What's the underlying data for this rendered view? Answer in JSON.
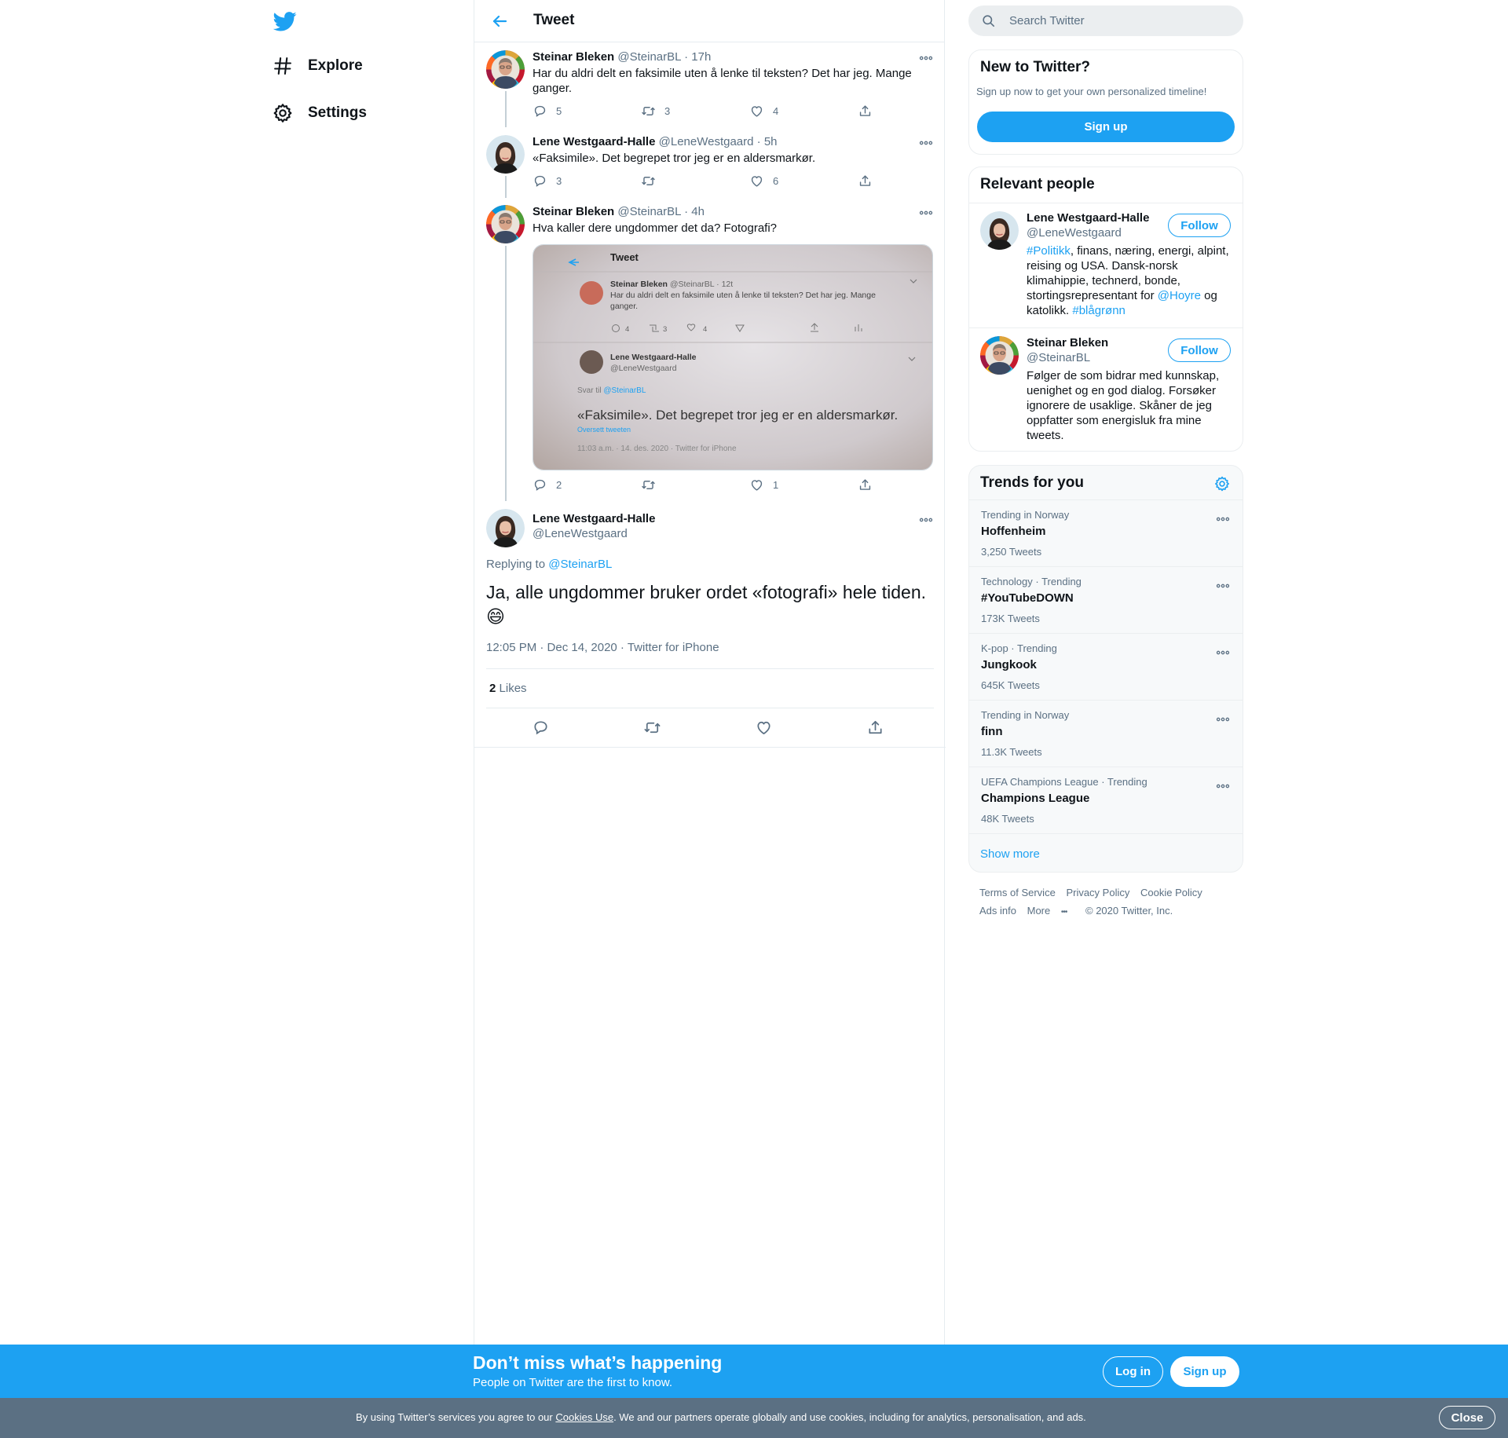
{
  "nav": {
    "explore": "Explore",
    "settings": "Settings"
  },
  "header": {
    "title": "Tweet"
  },
  "thread": [
    {
      "name": "Steinar Bleken",
      "handle": "@SteinarBL",
      "time": "· 17h",
      "text": "Har du aldri delt en faksimile uten å lenke til teksten?  Det har jeg. Mange ganger.",
      "replies": "5",
      "retweets": "3",
      "likes": "4"
    },
    {
      "name": "Lene Westgaard-Halle",
      "handle": "@LeneWestgaard",
      "time": "· 5h",
      "text": "«Faksimile». Det begrepet tror jeg er en aldersmarkør.",
      "replies": "3",
      "retweets": "",
      "likes": "6"
    },
    {
      "name": "Steinar Bleken",
      "handle": "@SteinarBL",
      "time": "· 4h",
      "text": "Hva kaller dere ungdommer det da? Fotografi?",
      "replies": "2",
      "retweets": "",
      "likes": "1"
    }
  ],
  "photo": {
    "title": "Tweet",
    "t1_name": "Steinar Bleken",
    "t1_handle": "@SteinarBL · 12t",
    "t1_line1": "Har du aldri delt en faksimile uten å lenke til teksten?  Det har jeg. Mange",
    "t1_line2": "ganger.",
    "t1_replies": "4",
    "t1_retweets": "3",
    "t1_likes": "4",
    "t2_name": "Lene Westgaard-Halle",
    "t2_handle": "@LeneWestgaard",
    "reply_prefix": "Svar til",
    "reply_handle": "@SteinarBL",
    "big_text": "«Faksimile». Det begrepet tror jeg er en aldersmarkør.",
    "translate": "Oversett tweeten",
    "meta": "11:03 a.m. · 14. des. 2020 · Twitter for iPhone"
  },
  "focus": {
    "name": "Lene Westgaard-Halle",
    "handle": "@LeneWestgaard",
    "replying_prefix": "Replying to",
    "replying_handle": "@SteinarBL",
    "text": "Ja, alle ungdommer bruker ordet «fotografi» hele tiden.",
    "emoji": "😄",
    "meta": "12:05 PM · Dec 14, 2020 · Twitter for iPhone",
    "likes_count": "2",
    "likes_label": "Likes"
  },
  "search": {
    "placeholder": "Search Twitter"
  },
  "new_to_twitter": {
    "title": "New to Twitter?",
    "subtitle": "Sign up now to get your own personalized timeline!",
    "button": "Sign up"
  },
  "relevant": {
    "title": "Relevant people",
    "people": [
      {
        "name": "Lene Westgaard-Halle",
        "handle": "@LeneWestgaard",
        "follow": "Follow",
        "bio_tag1": "#Politikk",
        "bio_part1": ", finans, næring, energi, alpint, reising og USA. Dansk-norsk klimahippie, technerd, bonde, stortingsrepresentant for ",
        "bio_tag2": "@Hoyre",
        "bio_part2": " og katolikk. ",
        "bio_tag3": "#blågrønn"
      },
      {
        "name": "Steinar Bleken",
        "handle": "@SteinarBL",
        "follow": "Follow",
        "bio": "Følger de som bidrar med kunnskap, uenighet og en god dialog. Forsøker ignorere de usaklige. Skåner de jeg oppfatter som energisluk fra mine tweets."
      }
    ]
  },
  "trends": {
    "title": "Trends for you",
    "items": [
      {
        "context": "Trending in Norway",
        "name": "Hoffenheim",
        "count": "3,250 Tweets"
      },
      {
        "context": "Technology · Trending",
        "name": "#YouTubeDOWN",
        "count": "173K Tweets"
      },
      {
        "context": "K-pop · Trending",
        "name": "Jungkook",
        "count": "645K Tweets"
      },
      {
        "context": "Trending in Norway",
        "name": "finn",
        "count": "11.3K Tweets"
      },
      {
        "context": "UEFA Champions League · Trending",
        "name": "Champions League",
        "count": "48K Tweets"
      }
    ],
    "show_more": "Show more"
  },
  "footer": {
    "terms": "Terms of Service",
    "privacy": "Privacy Policy",
    "cookie": "Cookie Policy",
    "ads": "Ads info",
    "more": "More",
    "copyright": "© 2020 Twitter, Inc."
  },
  "signup_bar": {
    "title": "Don’t miss what’s happening",
    "subtitle": "People on Twitter are the first to know.",
    "login": "Log in",
    "signup": "Sign up"
  },
  "cookie_bar": {
    "text_before": "By using Twitter’s services you agree to our ",
    "link": "Cookies Use",
    "text_after": ". We and our partners operate globally and use cookies, including for analytics, personalisation, and ads.",
    "close": "Close"
  },
  "colors": {
    "brand": "#1da1f2",
    "secondary_text": "#5b7083",
    "cookie_bar": "#5b7083"
  }
}
